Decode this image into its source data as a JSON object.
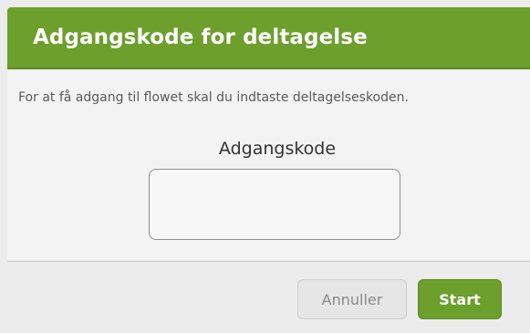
{
  "dialog": {
    "title": "Adgangskode for deltagelse",
    "instruction": "For at få adgang til flowet skal du indtaste deltagelseskoden.",
    "field_label": "Adgangskode",
    "code_value": "",
    "cancel_label": "Annuller",
    "start_label": "Start"
  },
  "colors": {
    "accent": "#6c9f2c",
    "background": "#ececec"
  }
}
